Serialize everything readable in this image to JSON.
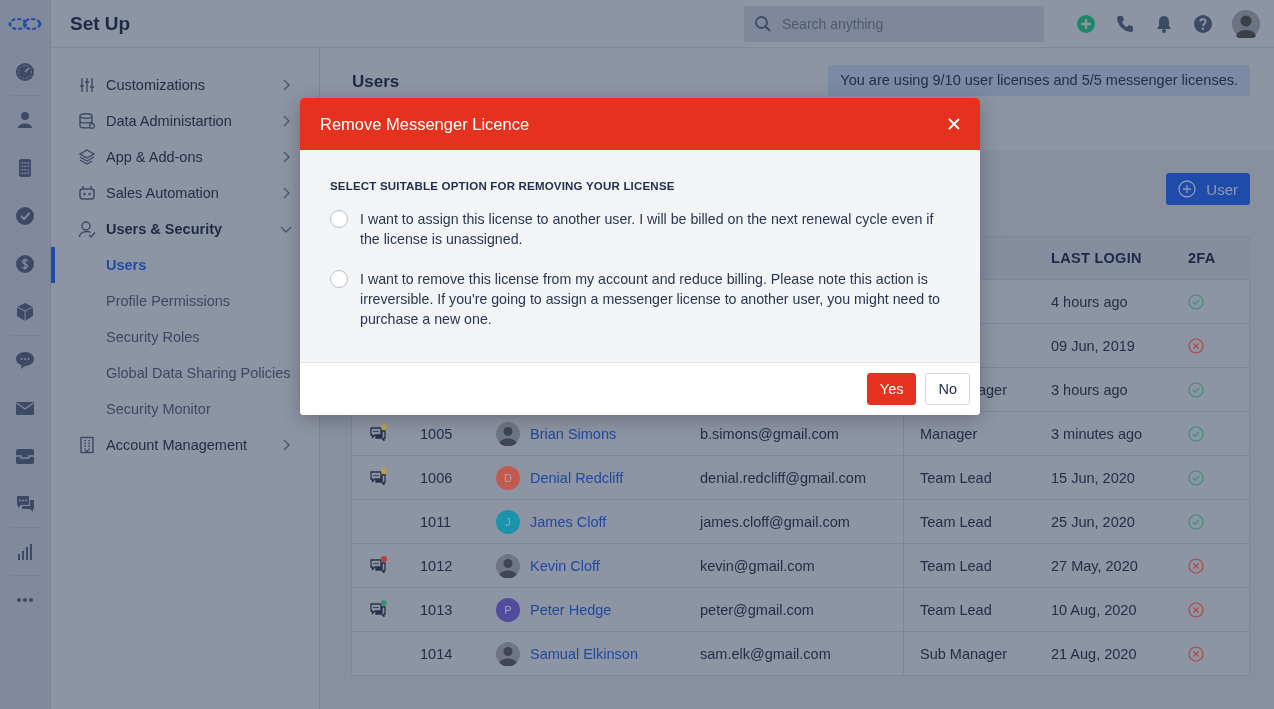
{
  "app": {
    "title": "Set Up"
  },
  "search": {
    "placeholder": "Search anything"
  },
  "settings_menu": [
    {
      "label": "Customizations",
      "expanded": false
    },
    {
      "label": "Data Administartion",
      "expanded": false
    },
    {
      "label": "App & Add-ons",
      "expanded": false
    },
    {
      "label": "Sales Automation",
      "expanded": false
    },
    {
      "label": "Users & Security",
      "expanded": true,
      "children": [
        {
          "label": "Users",
          "selected": true
        },
        {
          "label": "Profile Permissions",
          "selected": false
        },
        {
          "label": "Security Roles",
          "selected": false
        },
        {
          "label": "Global Data Sharing Policies",
          "selected": false
        },
        {
          "label": "Security Monitor",
          "selected": false
        }
      ]
    },
    {
      "label": "Account Management",
      "expanded": false
    }
  ],
  "page": {
    "title": "Users",
    "license_notice": "You are using 9/10 user licenses and 5/5 messenger licenses.",
    "add_button": "User"
  },
  "table": {
    "columns": [
      "LAST LOGIN",
      "2FA"
    ],
    "rows": [
      {
        "last_login": "4 hours ago",
        "two_fa": true
      },
      {
        "last_login": "09 Jun, 2019",
        "two_fa": false
      },
      {
        "role": "ager",
        "role_cut": true,
        "last_login": "3 hours ago",
        "two_fa": true
      },
      {
        "messenger": {
          "color": "#b9a04a"
        },
        "id": "1005",
        "name": "Brian Simons",
        "avatar": {
          "kind": "photo"
        },
        "email": "b.simons@gmail.com",
        "role": "Manager",
        "last_login": "3 minutes ago",
        "two_fa": true
      },
      {
        "messenger": {
          "color": "#b9a04a"
        },
        "id": "1006",
        "name": "Denial Redcliff",
        "avatar": {
          "kind": "letter",
          "letter": "D",
          "color": "#c25a50"
        },
        "email": "denial.redcliff@gmail.com",
        "role": "Team Lead",
        "last_login": "15 Jun, 2020",
        "two_fa": true
      },
      {
        "id": "1011",
        "name": "James Cloff",
        "avatar": {
          "kind": "letter",
          "letter": "J",
          "color": "#1a93ad"
        },
        "email": "james.cloff@gmail.com",
        "role": "Team Lead",
        "last_login": "25 Jun, 2020",
        "two_fa": true
      },
      {
        "messenger": {
          "color": "#b8403c"
        },
        "id": "1012",
        "name": "Kevin Cloff",
        "avatar": {
          "kind": "photo"
        },
        "email": "kevin@gmail.com",
        "role": "Team Lead",
        "last_login": "27 May, 2020",
        "two_fa": false
      },
      {
        "messenger": {
          "color": "#3a9272"
        },
        "id": "1013",
        "name": "Peter Hedge",
        "avatar": {
          "kind": "letter",
          "letter": "P",
          "color": "#514ca0"
        },
        "email": "peter@gmail.com",
        "role": "Team Lead",
        "last_login": "10 Aug, 2020",
        "two_fa": false
      },
      {
        "id": "1014",
        "name": "Samual Elkinson",
        "avatar": {
          "kind": "photo"
        },
        "email": "sam.elk@gmail.com",
        "role": "Sub Manager",
        "last_login": "21 Aug, 2020",
        "two_fa": false
      }
    ]
  },
  "modal": {
    "title": "Remove Messenger Licence",
    "heading": "SELECT SUITABLE OPTION FOR REMOVING YOUR LICENSE",
    "options": [
      {
        "text": "I want to assign this license to another user. I will be billed on the next renewal cycle even if the license is unassigned.",
        "selected": false
      },
      {
        "text": "I want to remove this license from my account and reduce billing. Please note this action is irreversible. If you're going to assign a messenger license to another user, you might need to purchase a new one.",
        "selected": false
      }
    ],
    "buttons": [
      {
        "label": "Yes",
        "kind": "primary"
      },
      {
        "label": "No",
        "kind": "secondary"
      }
    ]
  }
}
